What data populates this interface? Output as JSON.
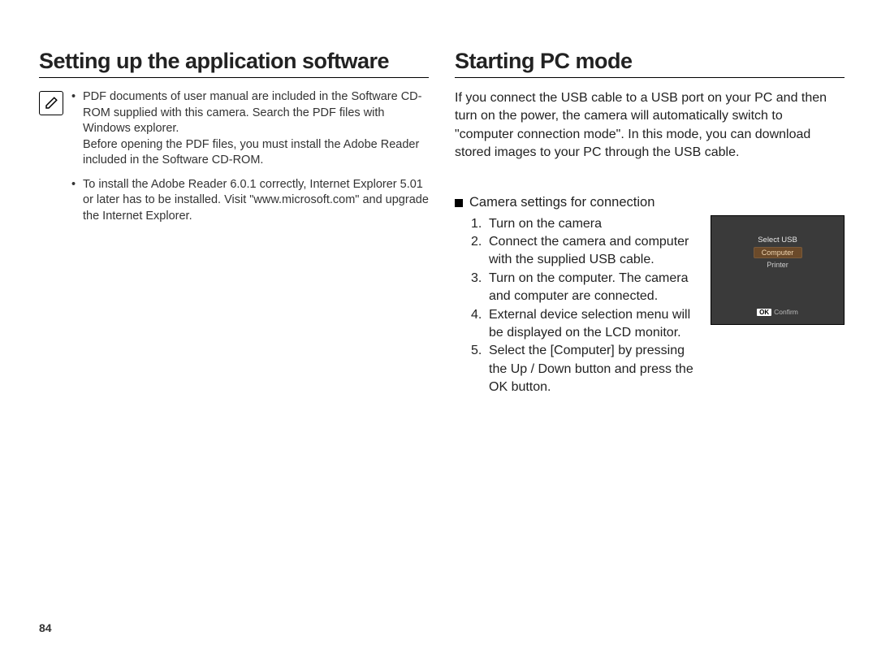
{
  "page_number": "84",
  "left": {
    "heading": "Setting up the application software",
    "bullets": [
      "PDF documents of user manual are included in the Software CD-ROM supplied with this camera. Search the PDF files with Windows explorer.\nBefore opening the PDF files, you must install the Adobe Reader included in the Software CD-ROM.",
      "To install the Adobe Reader 6.0.1 correctly, Internet Explorer 5.01 or later has to be installed. Visit \"www.microsoft.com\" and upgrade the Internet Explorer."
    ]
  },
  "right": {
    "heading": "Starting PC mode",
    "intro": "If you connect the USB cable to a USB port on your PC and then turn on the power, the camera will automatically switch to \"computer connection mode\". In this mode, you can download stored images to your PC through the USB cable.",
    "subhead": "Camera settings for connection",
    "steps": [
      "Turn on the camera",
      "Connect the camera and computer with the supplied USB cable.",
      "Turn on the computer. The camera and computer are connected.",
      "External device selection menu will be displayed on the LCD monitor.",
      "Select the [Computer] by pressing the Up / Down button and press the OK button."
    ],
    "lcd": {
      "title": "Select USB",
      "option_selected": "Computer",
      "option_other": "Printer",
      "ok": "OK",
      "confirm": "Confirm"
    }
  }
}
